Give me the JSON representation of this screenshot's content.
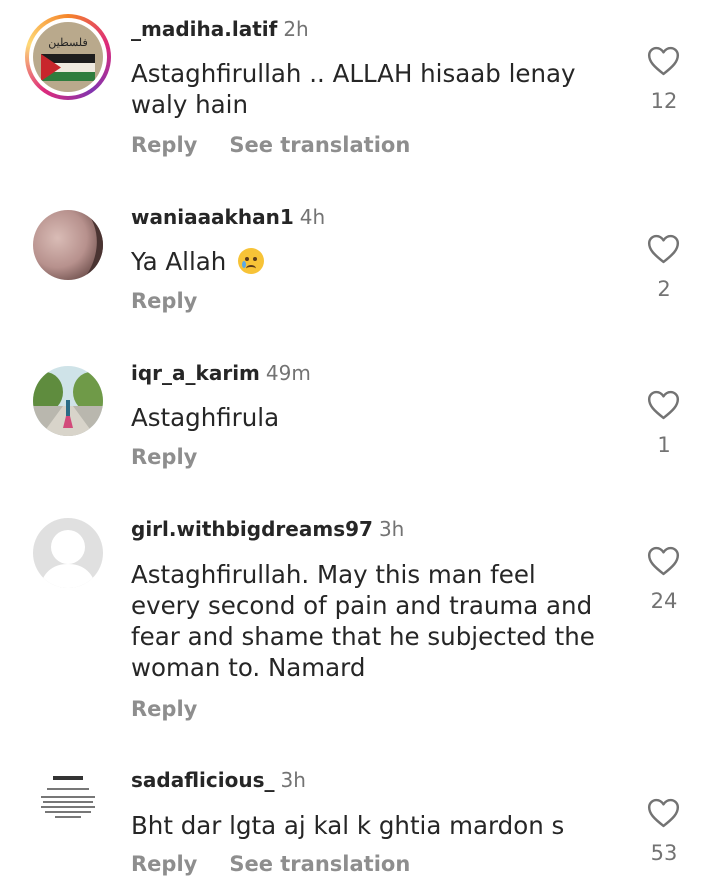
{
  "comments": [
    {
      "username": "_madiha.latif",
      "time": "2h",
      "text": "Astaghfirullah .. ALLAH hisaab lenay waly hain",
      "reply_label": "Reply",
      "translate_label": "See translation",
      "likes": "12",
      "avatar_text": "فلسطين"
    },
    {
      "username": "waniaaakhan1",
      "time": "4h",
      "text": "Ya Allah",
      "reply_label": "Reply",
      "likes": "2"
    },
    {
      "username": "iqr_a_karim",
      "time": "49m",
      "text": "Astaghfirula",
      "reply_label": "Reply",
      "likes": "1"
    },
    {
      "username": "girl.withbigdreams97",
      "time": "3h",
      "text": "Astaghfirullah. May this man feel every second of pain and trauma and fear and shame that he subjected the woman to. Namard",
      "reply_label": "Reply",
      "likes": "24"
    },
    {
      "username": "sadaflicious_",
      "time": "3h",
      "text": "Bht dar lgta aj kal k ghtia mardon s",
      "reply_label": "Reply",
      "translate_label": "See translation",
      "likes": "53"
    }
  ],
  "colors": {
    "text": "#262626",
    "muted": "#737373",
    "action": "#8e8e8e"
  }
}
